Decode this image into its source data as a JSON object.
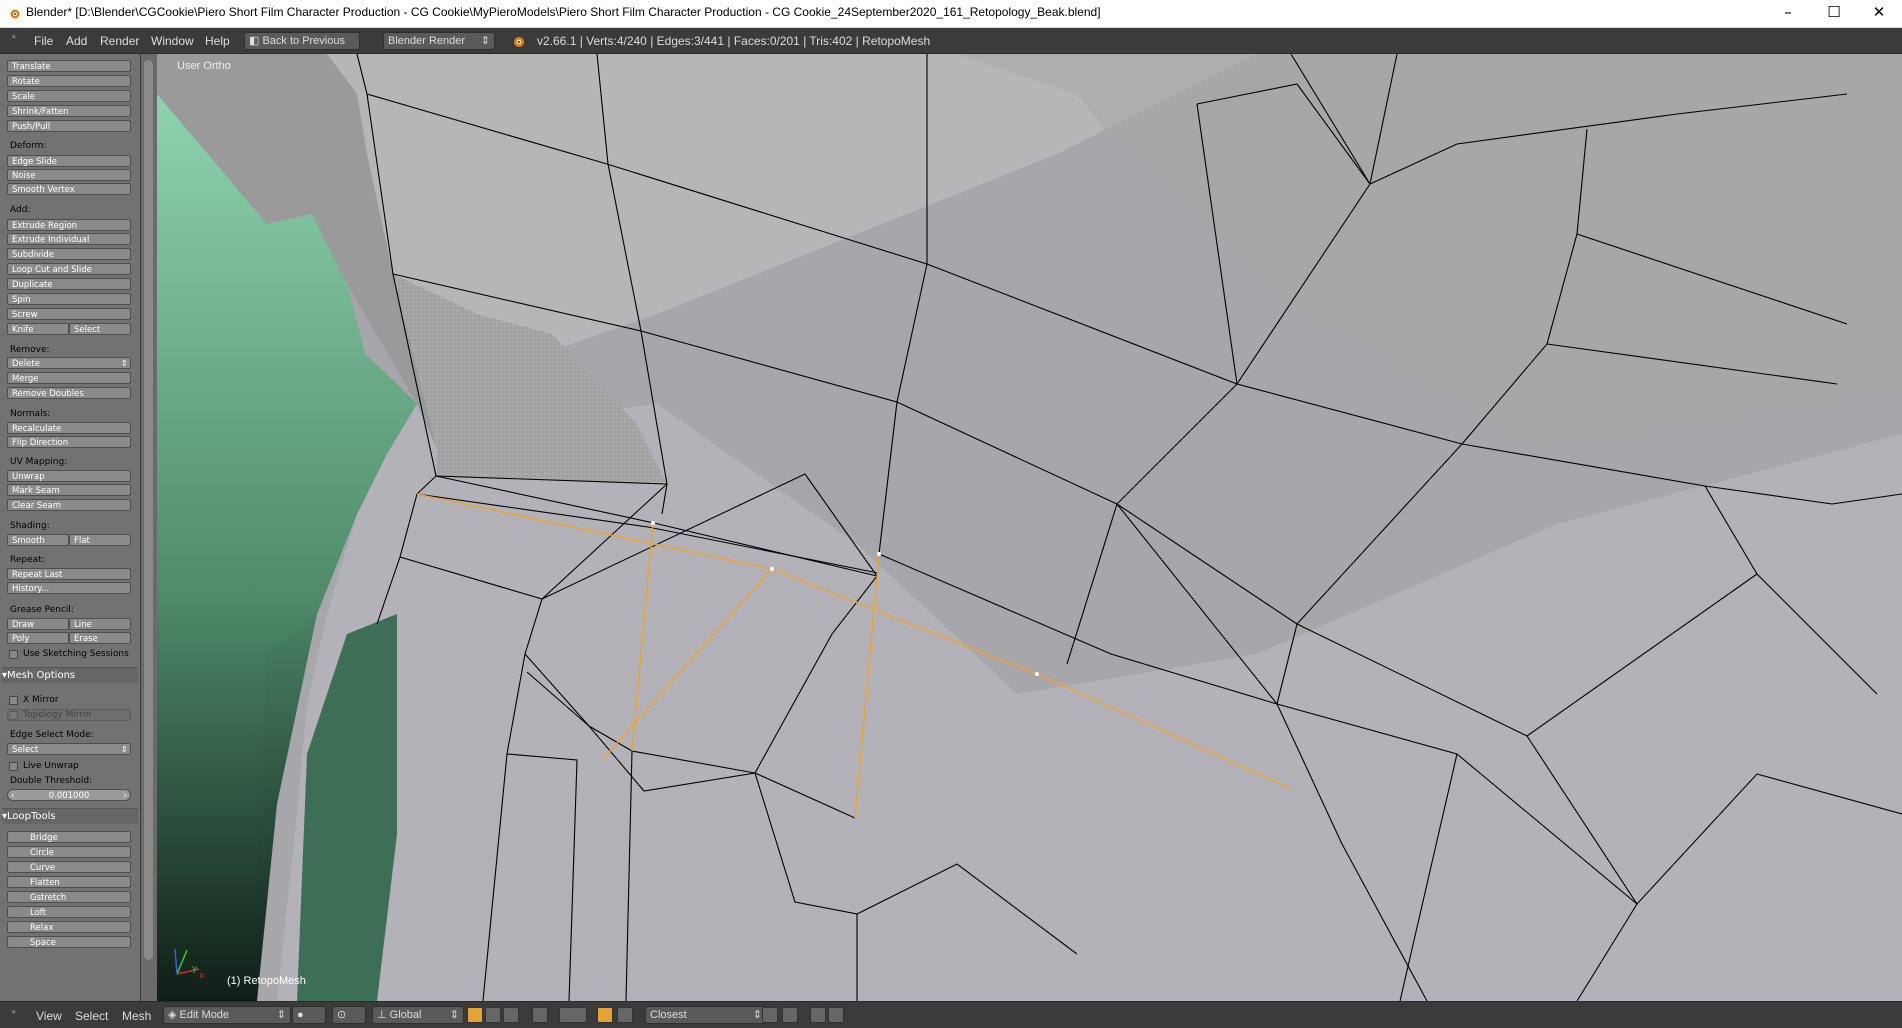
{
  "window": {
    "title": "Blender* [D:\\Blender\\CGCookie\\Piero Short Film Character Production - CG Cookie\\MyPieroModels\\Piero Short Film Character Production - CG Cookie_24September2020_161_Retopology_Beak.blend]",
    "minimize": "–",
    "maximize": "☐",
    "close": "✕"
  },
  "infobar": {
    "menus": [
      "File",
      "Add",
      "Render",
      "Window",
      "Help"
    ],
    "back_button": "Back to Previous",
    "engine": "Blender Render",
    "stats": "v2.66.1 | Verts:4/240 | Edges:3/441 | Faces:0/201 | Tris:402 | RetopoMesh"
  },
  "toolshelf": {
    "transform": [
      "Translate",
      "Rotate",
      "Scale",
      "Shrink/Fatten",
      "Push/Pull"
    ],
    "deform_label": "Deform:",
    "deform": [
      "Edge Slide",
      "Noise",
      "Smooth Vertex"
    ],
    "add_label": "Add:",
    "add": [
      "Extrude Region",
      "Extrude Individual",
      "Subdivide",
      "Loop Cut and Slide",
      "Duplicate",
      "Spin",
      "Screw"
    ],
    "knife": "Knife",
    "knife_select": "Select",
    "remove_label": "Remove:",
    "remove_delete": "Delete",
    "remove": [
      "Merge",
      "Remove Doubles"
    ],
    "normals_label": "Normals:",
    "normals": [
      "Recalculate",
      "Flip Direction"
    ],
    "uv_label": "UV Mapping:",
    "uv": [
      "Unwrap",
      "Mark Seam",
      "Clear Seam"
    ],
    "shading_label": "Shading:",
    "shading_smooth": "Smooth",
    "shading_flat": "Flat",
    "repeat_label": "Repeat:",
    "repeat": [
      "Repeat Last",
      "History..."
    ],
    "grease_label": "Grease Pencil:",
    "grease_draw": "Draw",
    "grease_line": "Line",
    "grease_poly": "Poly",
    "grease_erase": "Erase",
    "use_sketching": "Use Sketching Sessions",
    "mesh_options_header": "Mesh Options",
    "x_mirror": "X Mirror",
    "topology_mirror": "Topology Mirror",
    "edge_select_label": "Edge Select Mode:",
    "edge_select_value": "Select",
    "live_unwrap": "Live Unwrap",
    "double_threshold_label": "Double Threshold:",
    "double_threshold_value": "0.001000",
    "looptools_header": "LoopTools",
    "looptools": [
      "Bridge",
      "Circle",
      "Curve",
      "Flatten",
      "Gstretch",
      "Loft",
      "Relax",
      "Space"
    ]
  },
  "viewport": {
    "view_label": "User Ortho",
    "object_label": "(1) RetopoMesh"
  },
  "bottombar": {
    "menus": [
      "View",
      "Select",
      "Mesh"
    ],
    "mode": "Edit Mode",
    "orientation": "Global",
    "snap": "Closest"
  },
  "colors": {
    "selected_edge": "#f2a12a",
    "header_bg": "#3b3b3b",
    "panel_bg": "#727272"
  }
}
